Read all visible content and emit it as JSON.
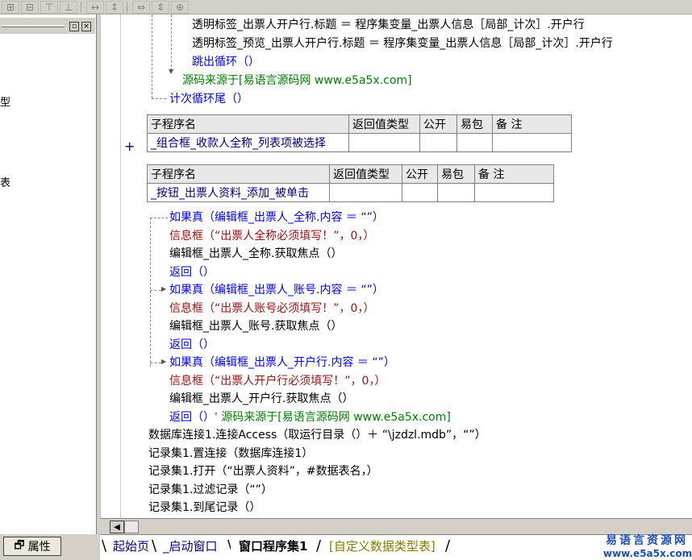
{
  "left_panel": {
    "fragments": [
      "型",
      "表"
    ],
    "minimize_label": "▫",
    "close_label": "×",
    "properties_tab": "属性"
  },
  "tables": [
    {
      "headers": [
        "子程序名",
        "返回值类型",
        "公开",
        "易包",
        "备 注"
      ],
      "row": [
        "_组合框_收款人全称_列表项被选择",
        "",
        "",
        "",
        ""
      ]
    },
    {
      "headers": [
        "子程序名",
        "返回值类型",
        "公开",
        "易包",
        "备 注"
      ],
      "row": [
        "_按钮_出票人资料_添加_被单击",
        "",
        "",
        "",
        ""
      ]
    }
  ],
  "expand_marker": "+",
  "code_top": [
    "透明标签_出票人开户行.标题 ＝ 程序集变量_出票人信息［局部_计次］.开户行",
    "透明标签_预览_出票人开户行.标题 ＝ 程序集变量_出票人信息［局部_计次］.开户行",
    "跳出循环（）",
    "源码来源于[易语言源码网 www.e5a5x.com]",
    "计次循环尾（）"
  ],
  "code_body": {
    "if1": "如果真（编辑框_出票人_全称.内容 ＝ “”）",
    "msg1": "信息框（“出票人全称必须填写！”，0，）",
    "focus1": "编辑框_出票人_全称.获取焦点（）",
    "ret1": "返回（）",
    "if2": "如果真（编辑框_出票人_账号.内容 ＝ “”）",
    "msg2": "信息框（“出票人账号必须填写！”，0，）",
    "focus2": "编辑框_出票人_账号.获取焦点（）",
    "ret2": "返回（）",
    "if3": "如果真（编辑框_出票人_开户行.内容 ＝ “”）",
    "msg3": "信息框（“出票人开户行必须填写！”，0，）",
    "focus3": "编辑框_出票人_开户行.获取焦点（）",
    "ret3": "返回（）",
    "ret3_comment": "' 源码来源于[易语言源码网 www.e5a5x.com]",
    "db1": "数据库连接1.连接Access（取运行目录（）＋ “\\jzdzl.mdb”，“”）",
    "rs1": "记录集1.置连接（数据库连接1）",
    "rs2": "记录集1.打开（“出票人资料”，#数据表名，）",
    "rs3": "记录集1.过滤记录（“”）",
    "rs4": "记录集1.到尾记录（）"
  },
  "tabs": {
    "start": "起始页",
    "startup": "_启动窗口",
    "active": "窗口程序集1",
    "custom": "[自定义数据类型表]"
  },
  "watermark": {
    "line1": "易语言资源网",
    "line2": "www.e5a5x.com"
  }
}
